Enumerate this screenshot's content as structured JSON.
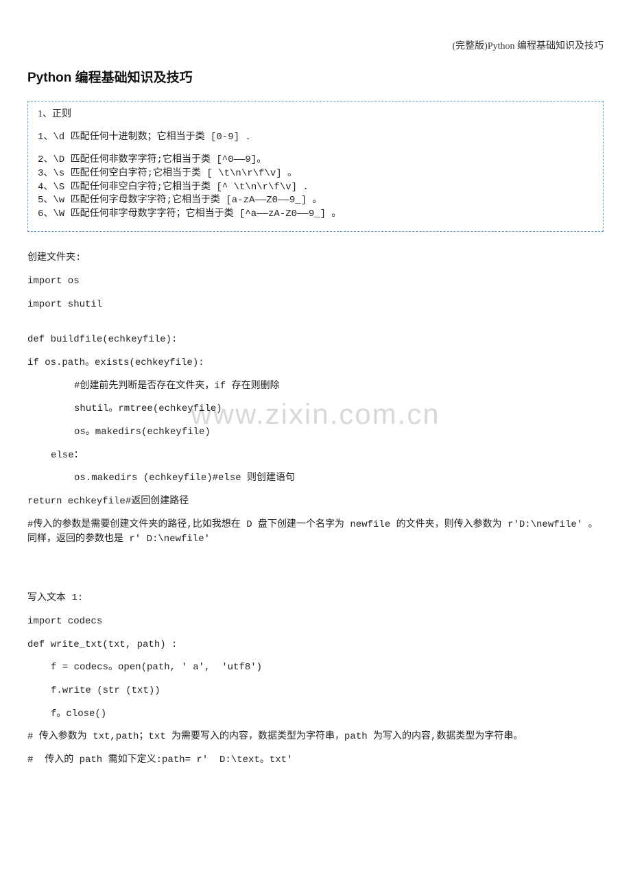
{
  "header": "(完整版)Python 编程基础知识及技巧",
  "title": "Python 编程基础知识及技巧",
  "box": {
    "head": "1、正则",
    "l1": "1、\\d  匹配任何十进制数；它相当于类  [0-9] .",
    "l2": "2、\\D  匹配任何非数字字符;它相当于类 [^0——9]。",
    "l3": "3、\\s  匹配任何空白字符;它相当于类  [ \\t\\n\\r\\f\\v] 。",
    "l4": "4、\\S  匹配任何非空白字符;它相当于类 [^ \\t\\n\\r\\f\\v] .",
    "l5": "5、\\w  匹配任何字母数字字符;它相当于类  [a-zA——Z0——9_] 。",
    "l6": "6、\\W  匹配任何非字母数字字符；它相当于类 [^a——zA-Z0——9_] 。"
  },
  "sec1": {
    "l1": "创建文件夹:",
    "l2": "import os",
    "l3": "import shutil",
    "l4": "def buildfile(echkeyfile):",
    "l5": "if os.path。exists(echkeyfile):",
    "l6": "#创建前先判断是否存在文件夹，if 存在则删除",
    "l7": "shutil。rmtree(echkeyfile)",
    "l8": "os。makedirs(echkeyfile)",
    "l9": "else：",
    "l10": "os.makedirs (echkeyfile)#else 则创建语句",
    "l11": "return echkeyfile#返回创建路径",
    "l12": "#传入的参数是需要创建文件夹的路径,比如我想在 D 盘下创建一个名字为 newfile 的文件夹，则传入参数为 r'D:\\newfile' 。同样，返回的参数也是 r' D:\\newfile'"
  },
  "sec2": {
    "l1": "写入文本 1:",
    "l2": "import codecs",
    "l3": "def write_txt(txt, path) :",
    "l4": "f = codecs。open(path, ' a',  'utf8')",
    "l5": "f.write (str (txt))",
    "l6": "f。close()",
    "l7": "# 传入参数为 txt,path；txt 为需要写入的内容，数据类型为字符串，path 为写入的内容,数据类型为字符串。",
    "l8": "#  传入的 path 需如下定义:path= r'  D:\\text。txt'"
  },
  "watermark": "www.zixin.com.cn"
}
